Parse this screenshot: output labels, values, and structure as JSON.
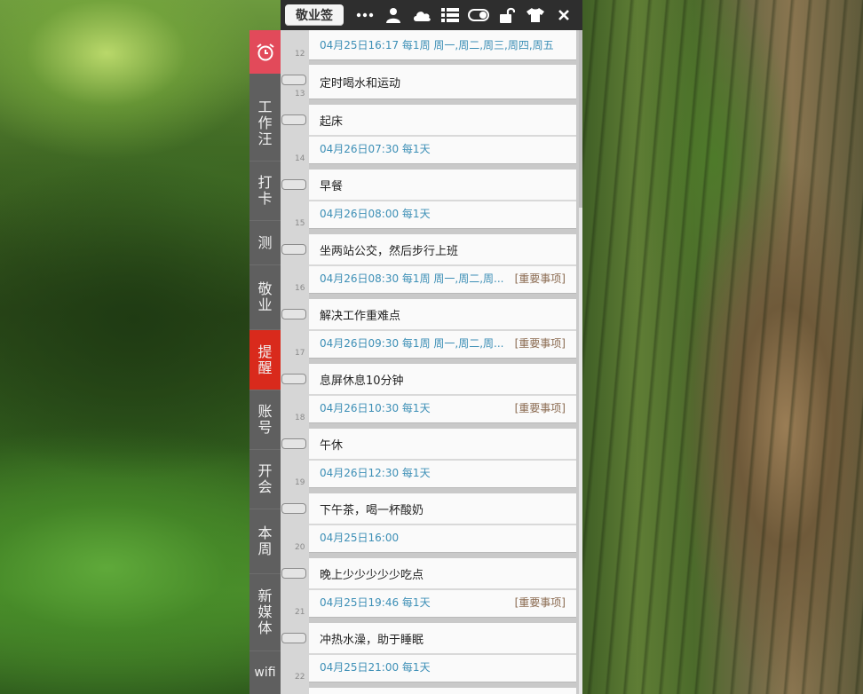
{
  "app": {
    "title": "敬业签"
  },
  "toolbar": {
    "icons": [
      "more-icon",
      "user-icon",
      "cloud-icon",
      "list-icon",
      "toggle-icon",
      "unlock-icon",
      "tshirt-icon",
      "close-icon"
    ]
  },
  "sidebar": {
    "tabs": [
      {
        "label": "工作汪"
      },
      {
        "label": "打卡"
      },
      {
        "label": "测"
      },
      {
        "label": "敬业"
      },
      {
        "label": "提醒"
      },
      {
        "label": "账号"
      },
      {
        "label": "开会"
      },
      {
        "label": "本周"
      },
      {
        "label": "新媒体"
      },
      {
        "label": "wifi"
      }
    ]
  },
  "reminders": [
    {
      "num": "12",
      "title": "",
      "meta": "04月25日16:17 每1周 周一,周二,周三,周四,周五",
      "tag": ""
    },
    {
      "num": "13",
      "title": "定时喝水和运动",
      "meta": "",
      "tag": ""
    },
    {
      "num": "14",
      "title": "起床",
      "meta": "04月26日07:30 每1天",
      "tag": ""
    },
    {
      "num": "15",
      "title": "早餐",
      "meta": "04月26日08:00 每1天",
      "tag": ""
    },
    {
      "num": "16",
      "title": "坐两站公交，然后步行上班",
      "meta": "04月26日08:30 每1周 周一,周二,周...",
      "tag": "[重要事项]"
    },
    {
      "num": "17",
      "title": "解决工作重难点",
      "meta": "04月26日09:30 每1周 周一,周二,周...",
      "tag": "[重要事项]"
    },
    {
      "num": "18",
      "title": "息屏休息10分钟",
      "meta": "04月26日10:30 每1天",
      "tag": "[重要事项]"
    },
    {
      "num": "19",
      "title": "午休",
      "meta": "04月26日12:30 每1天",
      "tag": ""
    },
    {
      "num": "20",
      "title": "下午茶，喝一杯酸奶",
      "meta": "04月25日16:00",
      "tag": ""
    },
    {
      "num": "21",
      "title": "晚上少少少少少吃点",
      "meta": "04月25日19:46 每1天",
      "tag": "[重要事项]"
    },
    {
      "num": "22",
      "title": "冲热水澡，助于睡眠",
      "meta": "04月25日21:00 每1天",
      "tag": ""
    }
  ]
}
